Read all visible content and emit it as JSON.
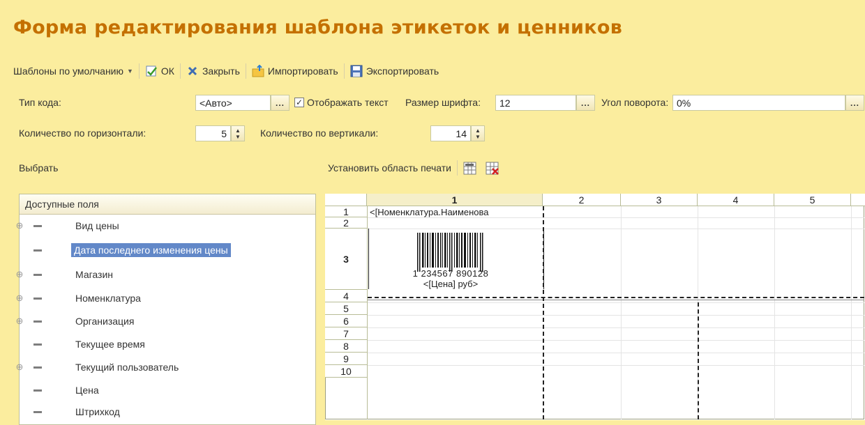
{
  "window": {
    "title": "Форма редактирования шаблона этикеток и ценников"
  },
  "toolbar": {
    "defaults_label": "Шаблоны по умолчанию",
    "ok_label": "ОК",
    "close_label": "Закрыть",
    "import_label": "Импортировать",
    "export_label": "Экспортировать"
  },
  "settings": {
    "code_type_label": "Тип кода:",
    "code_type_value": "<Авто>",
    "show_text_label": "Отображать текст",
    "show_text_checked": true,
    "font_size_label": "Размер шрифта:",
    "font_size_value": "12",
    "rotation_label": "Угол поворота:",
    "rotation_value": "0%",
    "horizontal_count_label": "Количество по горизонтали:",
    "horizontal_count_value": "5",
    "vertical_count_label": "Количество по вертикали:",
    "vertical_count_value": "14"
  },
  "left_panel": {
    "select_button": "Выбрать",
    "header": "Доступные поля",
    "items": [
      {
        "label": "Вид цены",
        "expandable": true,
        "selected": false
      },
      {
        "label": "Дата последнего изменения цены",
        "expandable": false,
        "selected": true
      },
      {
        "label": "Магазин",
        "expandable": true,
        "selected": false
      },
      {
        "label": "Номенклатура",
        "expandable": true,
        "selected": false
      },
      {
        "label": "Организация",
        "expandable": true,
        "selected": false
      },
      {
        "label": "Текущее время",
        "expandable": false,
        "selected": false
      },
      {
        "label": "Текущий пользователь",
        "expandable": true,
        "selected": false
      },
      {
        "label": "Цена",
        "expandable": false,
        "selected": false
      },
      {
        "label": "Штрихкод",
        "expandable": false,
        "selected": false
      }
    ]
  },
  "sheet_toolbar": {
    "set_print_area_label": "Установить область печати"
  },
  "sheet": {
    "columns": [
      "1",
      "2",
      "3",
      "4",
      "5"
    ],
    "rows": [
      "1",
      "2",
      "3",
      "4",
      "5",
      "6",
      "7",
      "8",
      "9",
      "10"
    ],
    "cell_r1c1": "<[Номенклатура.Наименова",
    "barcode_digits": "1 234567 890128",
    "price_text": "<[Цена] руб>"
  },
  "colors": {
    "background": "#fbed9e",
    "title": "#c47000",
    "selection": "#6288c8"
  }
}
